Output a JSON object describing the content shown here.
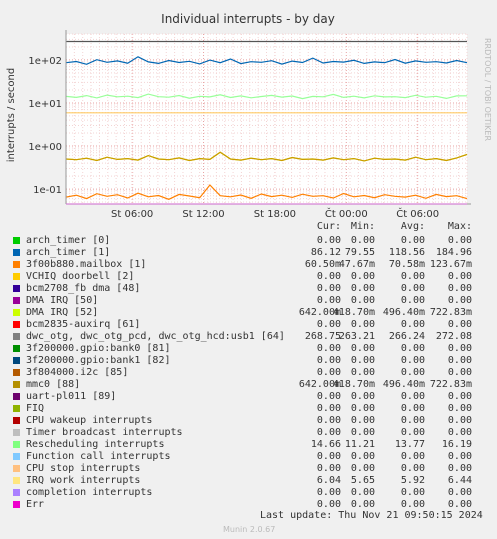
{
  "chart_data": {
    "type": "line",
    "title": "Individual interrupts - by day",
    "ylabel": "interrupts / second",
    "yscale": "log",
    "ylim": [
      0.045,
      400
    ],
    "ytick_labels": [
      "1e+02",
      "1e+01",
      "1e+00",
      "1e-01"
    ],
    "yticks": [
      100,
      10,
      1,
      0.1
    ],
    "xtick_labels": [
      "St 06:00",
      "St 12:00",
      "St 18:00",
      "Čt 00:00",
      "Čt 06:00"
    ],
    "grid": true,
    "series": [
      {
        "name": "arch_timer [1]",
        "color": "#0066b3",
        "values": [
          86,
          92,
          79,
          101,
          88,
          95,
          84,
          118,
          90,
          83,
          97,
          87,
          93,
          81,
          99,
          86,
          105,
          82,
          91,
          88,
          96,
          80,
          94,
          87,
          110,
          85,
          92,
          89,
          98,
          83,
          90,
          86,
          102,
          84,
          95,
          88,
          91,
          85,
          97,
          86
        ]
      },
      {
        "name": "3f00b880.mailbox [1]",
        "color": "#ff8000",
        "values": [
          0.065,
          0.072,
          0.06,
          0.078,
          0.068,
          0.074,
          0.062,
          0.08,
          0.066,
          0.071,
          0.058,
          0.075,
          0.069,
          0.063,
          0.124,
          0.07,
          0.066,
          0.073,
          0.061,
          0.077,
          0.067,
          0.072,
          0.064,
          0.076,
          0.068,
          0.07,
          0.062,
          0.079,
          0.066,
          0.071,
          0.063,
          0.074,
          0.068,
          0.065,
          0.072,
          0.061,
          0.075,
          0.067,
          0.07,
          0.06
        ]
      },
      {
        "name": "DMA IRQ [52]",
        "color": "#ccff00",
        "values": [
          0.5,
          0.48,
          0.52,
          0.46,
          0.55,
          0.49,
          0.51,
          0.47,
          0.6,
          0.5,
          0.48,
          0.53,
          0.46,
          0.51,
          0.49,
          0.72,
          0.5,
          0.47,
          0.52,
          0.48,
          0.51,
          0.46,
          0.54,
          0.49,
          0.5,
          0.47,
          0.53,
          0.48,
          0.51,
          0.45,
          0.52,
          0.49,
          0.5,
          0.47,
          0.55,
          0.48,
          0.51,
          0.46,
          0.53,
          0.64
        ]
      },
      {
        "name": "mmc0 [88]",
        "color": "#cc9900",
        "values": [
          0.5,
          0.48,
          0.52,
          0.46,
          0.55,
          0.49,
          0.51,
          0.47,
          0.6,
          0.5,
          0.48,
          0.53,
          0.46,
          0.51,
          0.49,
          0.72,
          0.5,
          0.47,
          0.52,
          0.48,
          0.51,
          0.46,
          0.54,
          0.49,
          0.5,
          0.47,
          0.53,
          0.48,
          0.51,
          0.45,
          0.52,
          0.49,
          0.5,
          0.47,
          0.55,
          0.48,
          0.51,
          0.46,
          0.53,
          0.64
        ]
      },
      {
        "name": "Rescheduling interrupts",
        "color": "#99ff99",
        "values": [
          14.2,
          13.5,
          14.8,
          13.1,
          15.2,
          13.9,
          14.4,
          13.3,
          16.1,
          14.0,
          13.6,
          14.9,
          12.9,
          14.3,
          13.8,
          15.5,
          13.4,
          14.6,
          13.2,
          14.1,
          15.0,
          13.7,
          14.5,
          12.6,
          14.2,
          13.9,
          15.8,
          13.5,
          14.4,
          13.1,
          14.7,
          13.8,
          14.0,
          13.3,
          15.1,
          13.6,
          14.3,
          12.8,
          14.6,
          14.7
        ]
      },
      {
        "name": "IRQ work interrupts",
        "color": "#ffcc66",
        "values": [
          5.9,
          5.9,
          5.9,
          5.9,
          5.9,
          5.9,
          5.9,
          5.9,
          5.9,
          5.9,
          5.9,
          5.9,
          5.9,
          5.9,
          5.9,
          5.9,
          5.9,
          5.9,
          5.9,
          5.9,
          5.9,
          5.9,
          5.9,
          5.9,
          5.9,
          5.9,
          5.9,
          5.9,
          5.9,
          5.9,
          5.9,
          5.9,
          5.9,
          5.9,
          5.9,
          5.9,
          5.9,
          5.9,
          5.9,
          5.9
        ]
      },
      {
        "name": "dwc_otg, dwc_otg_pcd, dwc_otg_hcd:usb1 [64]",
        "color": "#555555",
        "values": [
          268,
          268,
          268,
          268,
          268,
          268,
          268,
          268,
          268,
          268,
          268,
          268,
          268,
          268,
          268,
          268,
          268,
          268,
          268,
          268,
          268,
          268,
          268,
          268,
          268,
          268,
          268,
          268,
          268,
          268,
          268,
          268,
          268,
          268,
          268,
          268,
          268,
          268,
          268,
          268
        ]
      }
    ]
  },
  "legend": {
    "headers": {
      "cur": "Cur:",
      "min": "Min:",
      "avg": "Avg:",
      "max": "Max:"
    },
    "rows": [
      {
        "name": "arch_timer [0]",
        "color": "#00cc00",
        "cur": "0.00",
        "min": "0.00",
        "avg": "0.00",
        "max": "0.00"
      },
      {
        "name": "arch_timer [1]",
        "color": "#0066b3",
        "cur": "86.12",
        "min": "79.55",
        "avg": "118.56",
        "max": "184.96"
      },
      {
        "name": "3f00b880.mailbox [1]",
        "color": "#ff8000",
        "cur": "60.50m",
        "min": "47.67m",
        "avg": "70.58m",
        "max": "123.67m"
      },
      {
        "name": "VCHIQ doorbell [2]",
        "color": "#ffcc00",
        "cur": "0.00",
        "min": "0.00",
        "avg": "0.00",
        "max": "0.00"
      },
      {
        "name": "bcm2708_fb dma [48]",
        "color": "#330099",
        "cur": "0.00",
        "min": "0.00",
        "avg": "0.00",
        "max": "0.00"
      },
      {
        "name": "DMA IRQ [50]",
        "color": "#990099",
        "cur": "0.00",
        "min": "0.00",
        "avg": "0.00",
        "max": "0.00"
      },
      {
        "name": "DMA IRQ [52]",
        "color": "#ccff00",
        "cur": "642.00m",
        "min": "418.70m",
        "avg": "496.40m",
        "max": "722.83m"
      },
      {
        "name": "bcm2835-auxirq [61]",
        "color": "#ff0000",
        "cur": "0.00",
        "min": "0.00",
        "avg": "0.00",
        "max": "0.00"
      },
      {
        "name": "dwc_otg, dwc_otg_pcd, dwc_otg_hcd:usb1 [64]",
        "color": "#808080",
        "cur": "268.75",
        "min": "263.21",
        "avg": "266.24",
        "max": "272.08"
      },
      {
        "name": "3f200000.gpio:bank0 [81]",
        "color": "#008f00",
        "cur": "0.00",
        "min": "0.00",
        "avg": "0.00",
        "max": "0.00"
      },
      {
        "name": "3f200000.gpio:bank1 [82]",
        "color": "#00487d",
        "cur": "0.00",
        "min": "0.00",
        "avg": "0.00",
        "max": "0.00"
      },
      {
        "name": "3f804000.i2c [85]",
        "color": "#b35a00",
        "cur": "0.00",
        "min": "0.00",
        "avg": "0.00",
        "max": "0.00"
      },
      {
        "name": "mmc0 [88]",
        "color": "#b38f00",
        "cur": "642.00m",
        "min": "418.70m",
        "avg": "496.40m",
        "max": "722.83m"
      },
      {
        "name": "uart-pl011 [89]",
        "color": "#6b006b",
        "cur": "0.00",
        "min": "0.00",
        "avg": "0.00",
        "max": "0.00"
      },
      {
        "name": "FIQ",
        "color": "#8fb300",
        "cur": "0.00",
        "min": "0.00",
        "avg": "0.00",
        "max": "0.00"
      },
      {
        "name": "CPU wakeup interrupts",
        "color": "#b30000",
        "cur": "0.00",
        "min": "0.00",
        "avg": "0.00",
        "max": "0.00"
      },
      {
        "name": "Timer broadcast interrupts",
        "color": "#bebebe",
        "cur": "0.00",
        "min": "0.00",
        "avg": "0.00",
        "max": "0.00"
      },
      {
        "name": "Rescheduling interrupts",
        "color": "#80ff80",
        "cur": "14.66",
        "min": "11.21",
        "avg": "13.77",
        "max": "16.19"
      },
      {
        "name": "Function call interrupts",
        "color": "#80c9ff",
        "cur": "0.00",
        "min": "0.00",
        "avg": "0.00",
        "max": "0.00"
      },
      {
        "name": "CPU stop interrupts",
        "color": "#ffc080",
        "cur": "0.00",
        "min": "0.00",
        "avg": "0.00",
        "max": "0.00"
      },
      {
        "name": "IRQ work interrupts",
        "color": "#ffe680",
        "cur": "6.04",
        "min": "5.65",
        "avg": "5.92",
        "max": "6.44"
      },
      {
        "name": "completion interrupts",
        "color": "#aa80ff",
        "cur": "0.00",
        "min": "0.00",
        "avg": "0.00",
        "max": "0.00"
      },
      {
        "name": "Err",
        "color": "#ee00cc",
        "cur": "0.00",
        "min": "0.00",
        "avg": "0.00",
        "max": "0.00"
      }
    ]
  },
  "footer": {
    "last_update": "Last update: Thu Nov 21 09:50:15 2024",
    "version": "Munin 2.0.67",
    "side_text": "RRDTOOL / TOBI OETIKER"
  }
}
